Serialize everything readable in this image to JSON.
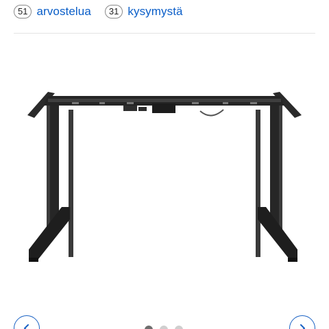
{
  "stats": {
    "reviews": {
      "count": "51",
      "label": "arvostelua"
    },
    "questions": {
      "count": "31",
      "label": "kysymystä"
    }
  },
  "carousel": {
    "total_slides": 3,
    "active_slide": 1,
    "prev_icon": "chevron-left-icon",
    "next_icon": "chevron-right-icon"
  },
  "colors": {
    "link": "#0a5ec8",
    "accent": "#1a62c4",
    "divider": "#e3e3e3",
    "product": "#1f1f1f"
  }
}
